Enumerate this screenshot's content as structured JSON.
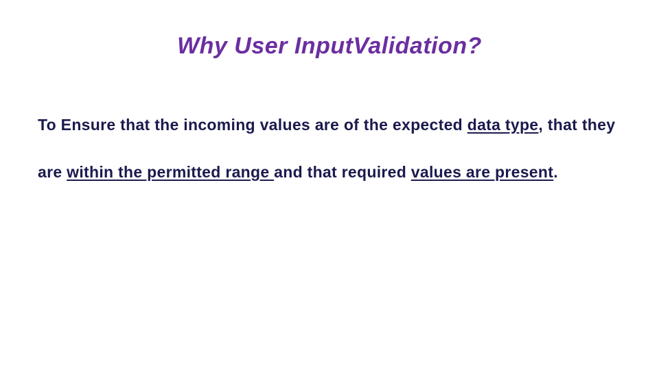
{
  "title": "Why User InputValidation?",
  "body": {
    "seg1": "To Ensure that the incoming values are of the expected ",
    "seg2_u": "data type",
    "seg3": ", that they are ",
    "seg4_u": "within the permitted range ",
    "seg5": "and that required ",
    "seg6_u": "values are present",
    "seg7": "."
  },
  "colors": {
    "title": "#6b2fa0",
    "body": "#1a1a4d"
  }
}
